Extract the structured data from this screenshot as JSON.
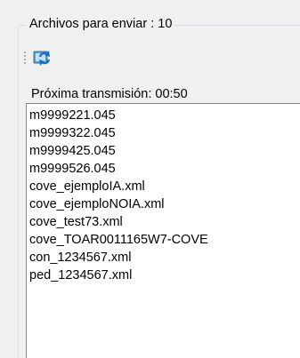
{
  "group": {
    "title": "Archivos para enviar : 10"
  },
  "toolbar": {
    "refresh_icon": "refresh-icon"
  },
  "status": {
    "next_transmission": "Próxima transmisión: 00:50"
  },
  "files": [
    "m9999221.045",
    "m9999322.045",
    "m9999425.045",
    "m9999526.045",
    "cove_ejemploIA.xml",
    "cove_ejemploNOIA.xml",
    "cove_test73.xml",
    "cove_TOAR0011165W7-COVE",
    "con_1234567.xml",
    "ped_1234567.xml"
  ]
}
